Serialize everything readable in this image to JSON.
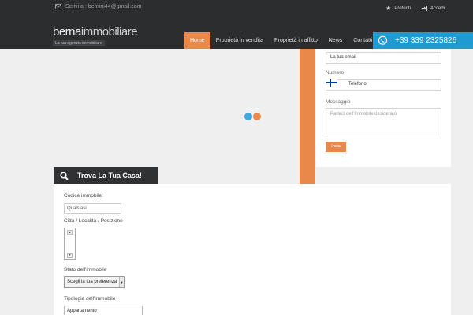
{
  "header": {
    "email_label": "Scrivi a : bernini44@gmail.com",
    "favorites_label": "Preferiti",
    "login_label": "Accedi",
    "logo": {
      "part1": "berna",
      "part2": "immobiliare",
      "tagline": "La tua agenzia immobiliare"
    },
    "nav": [
      {
        "label": "Home"
      },
      {
        "label": "Proprietà in vendita"
      },
      {
        "label": "Proprietà in affitto"
      },
      {
        "label": "News"
      },
      {
        "label": "Contatti"
      }
    ],
    "phone": "+39 339 2325826"
  },
  "contact_form": {
    "email_value": "La tua email",
    "number_label": "Numero",
    "phone_value": "Telefono",
    "message_label": "Messaggio",
    "message_placeholder": "Parlaci dell'immobile desiderato",
    "submit_label": "Invia"
  },
  "search": {
    "title": "Trova La Tua Casa!",
    "code_label": "Codice immobile:",
    "code_value": "Qualsiasi",
    "location_label": "Città / Località / Posizione",
    "status_label": "Stato dell'immobile",
    "status_value": "Scegli la tua preferenza",
    "type_label": "Tipologia dell'immobile",
    "type_value": "Appartamento"
  },
  "colors": {
    "accent": "#e8884a",
    "header_bg": "#2c2d2f",
    "phone_bg": "#1f9bd1",
    "loader_blue": "#3fa9e0",
    "loader_orange": "#e8884a"
  }
}
